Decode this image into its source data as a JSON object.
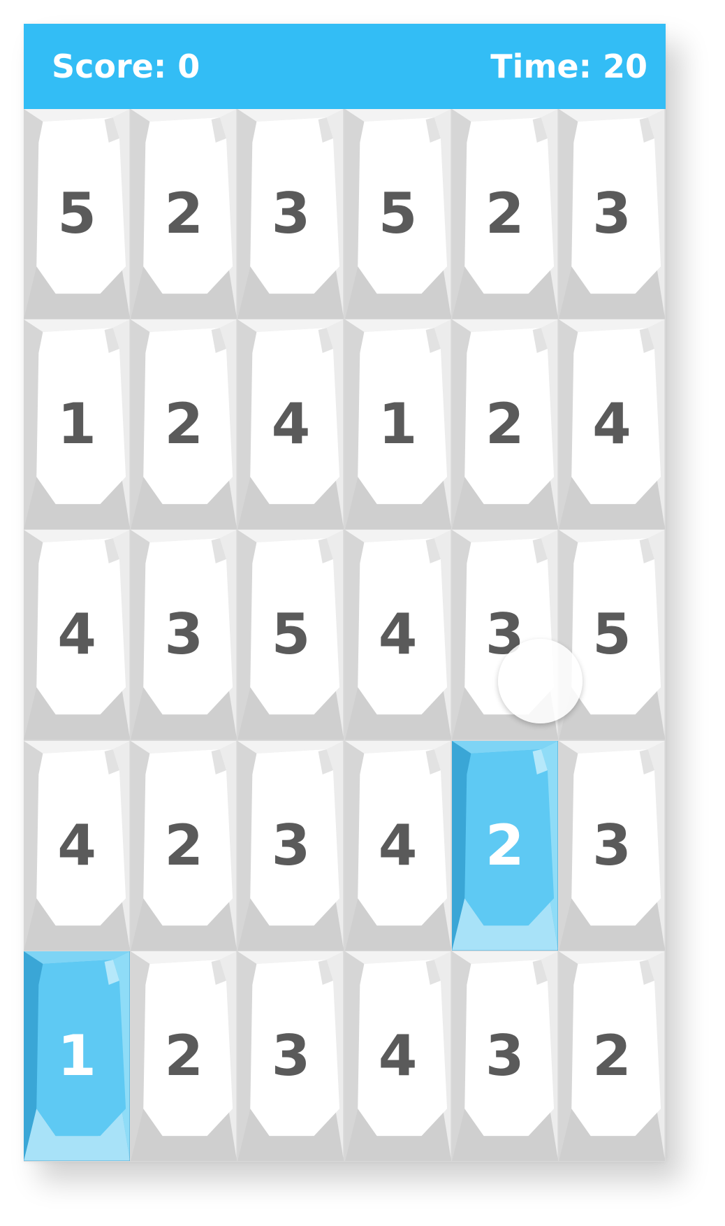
{
  "header": {
    "score_label": "Score: 0",
    "time_label": "Time: 20"
  },
  "board": {
    "rows": [
      [
        {
          "value": "5"
        },
        {
          "value": "2"
        },
        {
          "value": "3"
        },
        {
          "value": "5"
        },
        {
          "value": "2"
        },
        {
          "value": "3"
        }
      ],
      [
        {
          "value": "1"
        },
        {
          "value": "2"
        },
        {
          "value": "4"
        },
        {
          "value": "1"
        },
        {
          "value": "2"
        },
        {
          "value": "4"
        }
      ],
      [
        {
          "value": "4"
        },
        {
          "value": "3"
        },
        {
          "value": "5"
        },
        {
          "value": "4"
        },
        {
          "value": "3"
        },
        {
          "value": "5"
        }
      ],
      [
        {
          "value": "4"
        },
        {
          "value": "2"
        },
        {
          "value": "3"
        },
        {
          "value": "4"
        },
        {
          "value": "2",
          "selected": true
        },
        {
          "value": "3"
        }
      ],
      [
        {
          "value": "1",
          "selected": true
        },
        {
          "value": "2"
        },
        {
          "value": "3"
        },
        {
          "value": "4"
        },
        {
          "value": "3"
        },
        {
          "value": "2"
        }
      ]
    ]
  },
  "colors": {
    "header_bg": "#33bdf5",
    "tile_number": "#5a5a5a",
    "selected_tile": "#5bc8f2",
    "selected_number": "#ffffff"
  }
}
